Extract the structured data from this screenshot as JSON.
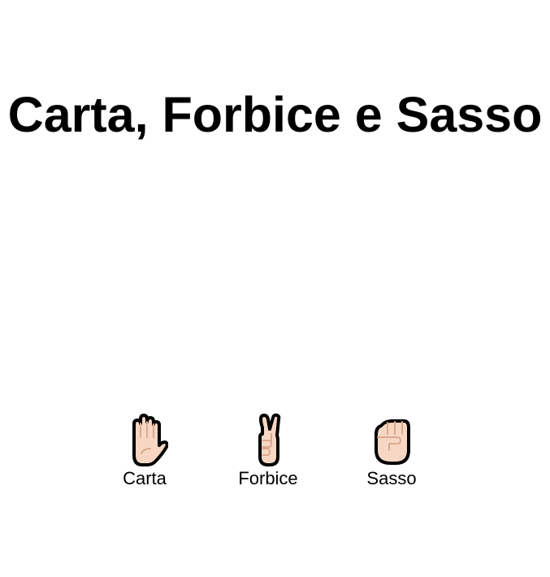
{
  "page": {
    "title": "Carta, Forbice e Sasso"
  },
  "choices": [
    {
      "label": "Carta",
      "icon": "raised-hand-icon"
    },
    {
      "label": "Forbice",
      "icon": "victory-hand-icon"
    },
    {
      "label": "Sasso",
      "icon": "raised-fist-icon"
    }
  ],
  "colors": {
    "background": "#ffffff",
    "text": "#000000",
    "skin": "#F7D7C4",
    "skin_line": "#D9A98E",
    "outline": "#000000"
  }
}
